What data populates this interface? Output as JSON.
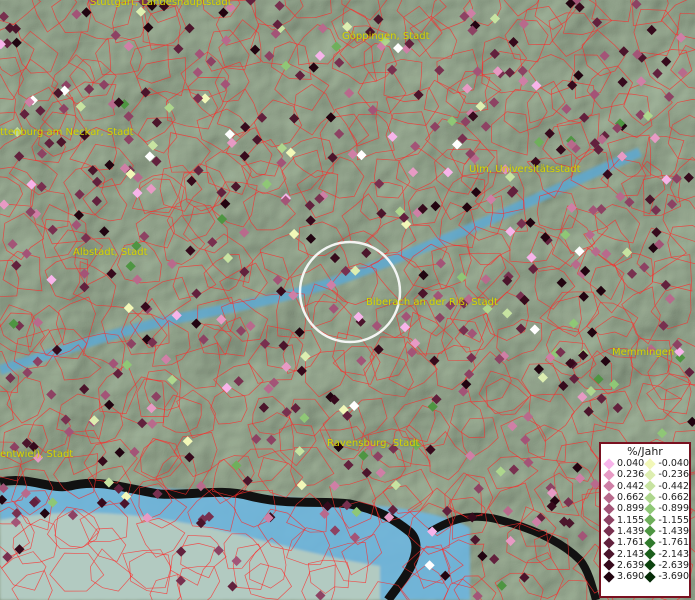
{
  "map": {
    "city_labels": [
      "Stuttgart, Landeshauptstadt",
      "Göppingen, Stadt",
      "ttenburg am Neckar, Stadt",
      "Ulm, Universitätsstadt",
      "Albstadt, Stadt",
      "Biberach an der Riß, Stadt",
      "Memmingen",
      "Ravensburg, Stadt",
      "entwiel), Stadt"
    ],
    "colors": {
      "border_lines": "#ff2a2a",
      "label_text": "#d6d400",
      "river_lake": "#4fa6d8",
      "highlight_circle": "#ffffff"
    }
  },
  "legend": {
    "title": "%/Jahr",
    "rows": [
      {
        "pos": "0.040",
        "pos_color": "#f7b4ea",
        "neg": "-0.040",
        "neg_color": "#f2f8b8"
      },
      {
        "pos": "0.236",
        "pos_color": "#e79ac4",
        "neg": "-0.236",
        "neg_color": "#ddeeb0"
      },
      {
        "pos": "0.442",
        "pos_color": "#cf7fa6",
        "neg": "-0.442",
        "neg_color": "#c7e3a1"
      },
      {
        "pos": "0.662",
        "pos_color": "#b86a8c",
        "neg": "-0.662",
        "neg_color": "#aed68d"
      },
      {
        "pos": "0.899",
        "pos_color": "#a35477",
        "neg": "-0.899",
        "neg_color": "#8fc776"
      },
      {
        "pos": "1.155",
        "pos_color": "#8d4263",
        "neg": "-1.155",
        "neg_color": "#6faf5b"
      },
      {
        "pos": "1.439",
        "pos_color": "#78304f",
        "neg": "-1.439",
        "neg_color": "#4e9542"
      },
      {
        "pos": "1.761",
        "pos_color": "#62213d",
        "neg": "-1.761",
        "neg_color": "#307a2c"
      },
      {
        "pos": "2.143",
        "pos_color": "#4b152b",
        "neg": "-2.143",
        "neg_color": "#1b5e1b"
      },
      {
        "pos": "2.639",
        "pos_color": "#360a1c",
        "neg": "-2.639",
        "neg_color": "#0d430f"
      },
      {
        "pos": "3.690",
        "pos_color": "#210410",
        "neg": "-3.690",
        "neg_color": "#052b07"
      }
    ]
  }
}
